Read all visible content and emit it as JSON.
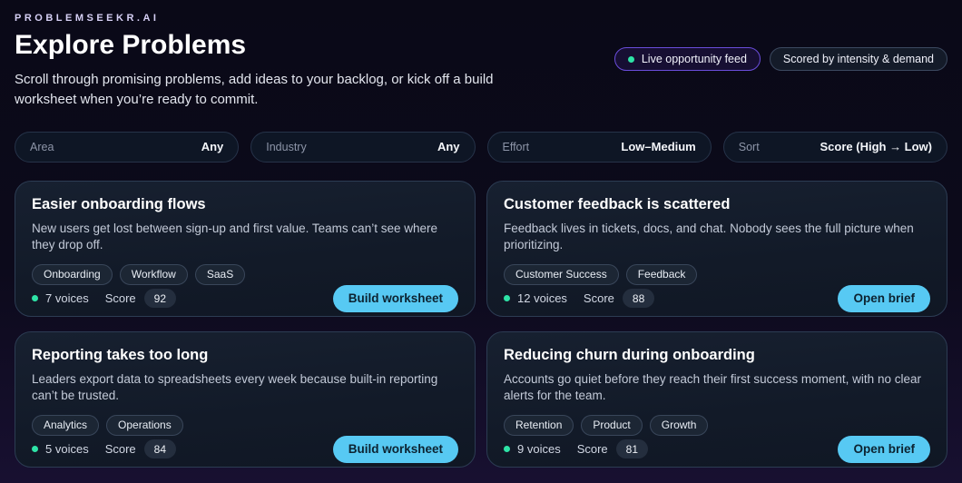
{
  "brand": "PROBLEMSEEKR.AI",
  "header": {
    "title": "Explore Problems",
    "subtitle": "Scroll through promising problems, add ideas to your backlog, or kick off a build worksheet when you’re ready to commit.",
    "live_badge": "Live opportunity feed",
    "scored_badge": "Scored by intensity & demand"
  },
  "filters": [
    {
      "label": "Area",
      "value": "Any"
    },
    {
      "label": "Industry",
      "value": "Any"
    },
    {
      "label": "Effort",
      "value": "Low–Medium"
    },
    {
      "label": "Sort",
      "value": "Score (High → Low)"
    }
  ],
  "score_label": "Score",
  "cards": [
    {
      "title": "Easier onboarding flows",
      "description": "New users get lost between sign-up and first value. Teams can’t see where they drop off.",
      "tags": [
        "Onboarding",
        "Workflow",
        "SaaS"
      ],
      "voices": "7 voices",
      "score": "92",
      "action": "Build worksheet"
    },
    {
      "title": "Customer feedback is scattered",
      "description": "Feedback lives in tickets, docs, and chat. Nobody sees the full picture when prioritizing.",
      "tags": [
        "Customer Success",
        "Feedback"
      ],
      "voices": "12 voices",
      "score": "88",
      "action": "Open brief"
    },
    {
      "title": "Reporting takes too long",
      "description": "Leaders export data to spreadsheets every week because built-in reporting can’t be trusted.",
      "tags": [
        "Analytics",
        "Operations"
      ],
      "voices": "5 voices",
      "score": "84",
      "action": "Build worksheet"
    },
    {
      "title": "Reducing churn during onboarding",
      "description": "Accounts go quiet before they reach their first success moment, with no clear alerts for the team.",
      "tags": [
        "Retention",
        "Product",
        "Growth"
      ],
      "voices": "9 voices",
      "score": "81",
      "action": "Open brief"
    }
  ],
  "colors": {
    "accent_cyan": "#57c9f3",
    "accent_purple": "#6a4ddb",
    "status_teal": "#2ee3a7",
    "page_bg_top": "#0a0917",
    "page_bg_bottom": "#181031",
    "card_bg": "#121a28"
  }
}
